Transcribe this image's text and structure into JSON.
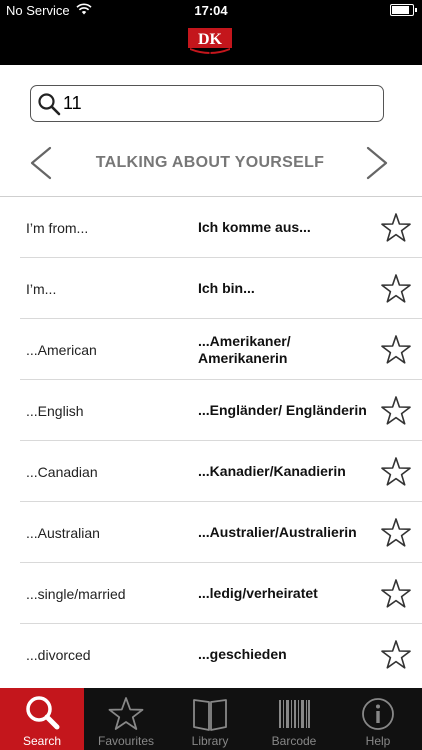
{
  "status": {
    "carrier": "No Service",
    "time": "17:04",
    "battery_level": 0.85
  },
  "brand": {
    "logo_text": "DK",
    "logo_color": "#c4161c"
  },
  "search": {
    "value": "11",
    "placeholder": ""
  },
  "chapter": {
    "title": "TALKING ABOUT YOURSELF"
  },
  "phrases": [
    {
      "en": "I’m from...",
      "de": "Ich komme aus..."
    },
    {
      "en": "I’m...",
      "de": "Ich bin..."
    },
    {
      "en": "...American",
      "de": "...Amerikaner/ Amerikanerin"
    },
    {
      "en": "...English",
      "de": "...Engländer/ Engländerin"
    },
    {
      "en": "...Canadian",
      "de": "...Kanadier/Kanadierin"
    },
    {
      "en": "...Australian",
      "de": "...Australier/Australierin"
    },
    {
      "en": "...single/married",
      "de": "...ledig/verheiratet"
    },
    {
      "en": "...divorced",
      "de": "...geschieden"
    }
  ],
  "tabs": [
    {
      "label": "Search",
      "icon": "search-icon",
      "active": true
    },
    {
      "label": "Favourites",
      "icon": "star-icon",
      "active": false
    },
    {
      "label": "Library",
      "icon": "book-icon",
      "active": false
    },
    {
      "label": "Barcode",
      "icon": "barcode-icon",
      "active": false
    },
    {
      "label": "Help",
      "icon": "info-icon",
      "active": false
    }
  ]
}
